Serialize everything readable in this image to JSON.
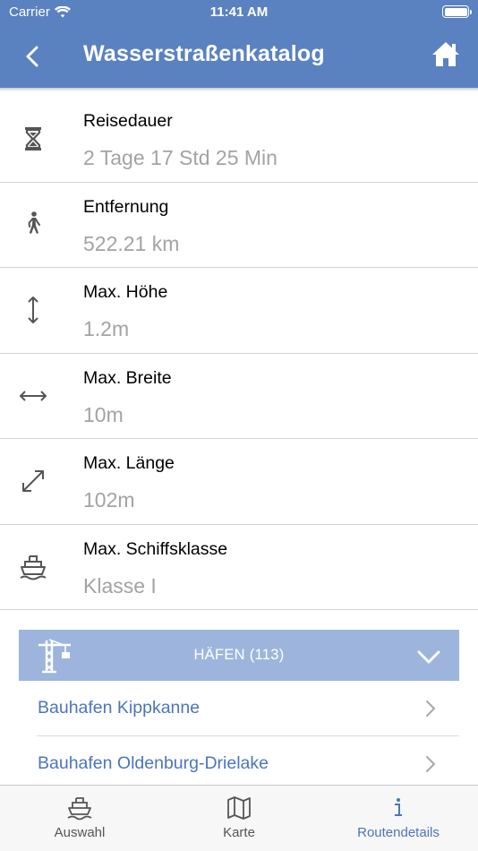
{
  "status_bar": {
    "carrier": "Carrier",
    "time": "11:41 AM"
  },
  "nav": {
    "title": "Wasserstraßenkatalog",
    "back_icon": "chevron-left-icon",
    "home_icon": "home-icon"
  },
  "details": [
    {
      "icon": "hourglass-icon",
      "label": "Reisedauer",
      "value": "2 Tage 17 Std 25 Min"
    },
    {
      "icon": "walking-person-icon",
      "label": "Entfernung",
      "value": "522.21 km"
    },
    {
      "icon": "vertical-arrows-icon",
      "label": "Max. Höhe",
      "value": "1.2m"
    },
    {
      "icon": "horizontal-arrows-icon",
      "label": "Max. Breite",
      "value": "10m"
    },
    {
      "icon": "diagonal-arrows-icon",
      "label": "Max. Länge",
      "value": "102m"
    },
    {
      "icon": "ship-icon",
      "label": "Max. Schiffsklasse",
      "value": "Klasse I"
    }
  ],
  "harbors": {
    "title": "HÄFEN (113)",
    "icon": "crane-icon",
    "items": [
      {
        "name": "Bauhafen Kippkanne"
      },
      {
        "name": "Bauhafen Oldenburg-Drielake"
      }
    ]
  },
  "tabs": [
    {
      "label": "Auswahl",
      "icon": "ship-icon",
      "active": false
    },
    {
      "label": "Karte",
      "icon": "map-icon",
      "active": false
    },
    {
      "label": "Routendetails",
      "icon": "info-icon",
      "active": true
    }
  ],
  "colors": {
    "header": "#5a82c0",
    "section_bar": "#9db5dc",
    "link": "#4c75ba",
    "value_gray": "#a3a3a3",
    "active_tab": "#4c75ba"
  }
}
